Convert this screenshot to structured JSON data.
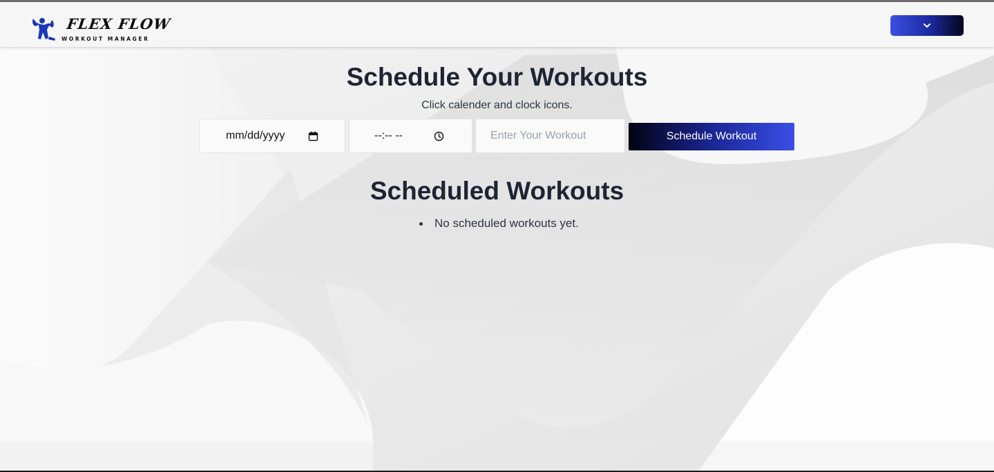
{
  "brand": {
    "name": "FLEX FLOW",
    "tagline": "WORKOUT MANAGER"
  },
  "nav": {
    "dropdown_icon": "chevron-down-icon"
  },
  "schedule": {
    "title": "Schedule Your Workouts",
    "subtitle": "Click calender and clock icons.",
    "date_value": "mm/dd/yyyy",
    "date_icon": "calendar-icon",
    "time_value": "--:-- --",
    "time_icon": "clock-icon",
    "workout_placeholder": "Enter Your Workout",
    "workout_value": "",
    "button_label": "Schedule Workout"
  },
  "scheduled": {
    "title": "Scheduled Workouts",
    "items": [
      "No scheduled workouts yet."
    ]
  },
  "colors": {
    "accent_blue": "#3b4fe0",
    "accent_dark": "#04041a",
    "heading": "#1e2433",
    "background": "#ececec"
  }
}
